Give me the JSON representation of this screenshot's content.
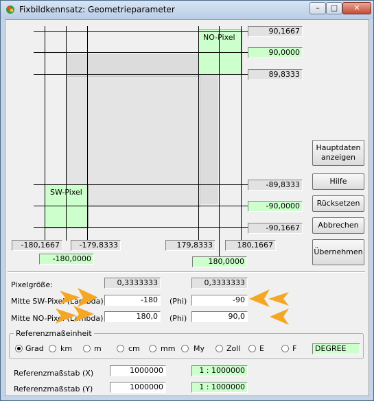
{
  "window": {
    "title": "Fixbildkennsatz: Geometrieparameter",
    "min": "–",
    "max": "□",
    "close": "✕"
  },
  "diagram": {
    "ne_pixel_label": "NO-Pixel",
    "sw_pixel_label": "SW-Pixel",
    "right_values": {
      "v1": "90,1667",
      "v2": "90,0000",
      "v3": "89,8333",
      "v4": "-89,8333",
      "v5": "-90,0000",
      "v6": "-90,1667"
    },
    "bottom_values": {
      "v1": "-180,1667",
      "v2": "-179,8333",
      "v3": "179,8333",
      "v4": "180,1667",
      "v5": "-180,0000",
      "v6": "180,0000"
    }
  },
  "buttons": {
    "hauptdaten": [
      "Hauptdaten",
      "anzeigen"
    ],
    "hilfe": "Hilfe",
    "ruecksetzen": "Rücksetzen",
    "abbrechen": "Abbrechen",
    "uebernehmen": "Übernehmen"
  },
  "params": {
    "pixelgroesse_label": "Pixelgröße:",
    "pixelgroesse_lambda": "0,3333333",
    "pixelgroesse_phi": "0,3333333",
    "sw_label": "Mitte SW-Pixel (Lambda)",
    "sw_lambda": "-180",
    "sw_phi": "-90",
    "no_label": "Mitte NO-Pixel (Lambda)",
    "no_lambda": "180,0",
    "no_phi": "90,0",
    "phi_label": "(Phi)"
  },
  "referenz": {
    "group_title": "Referenzmaßeinheit",
    "options": [
      "Grad",
      "km",
      "m",
      "cm",
      "mm",
      "My",
      "Zoll",
      "E",
      "F"
    ],
    "selected": "Grad",
    "unit_display": "DEGREE"
  },
  "massstab": {
    "x_label": "Referenzmaßstab (X)",
    "x_value": "1000000",
    "x_ratio": "1 : 1000000",
    "y_label": "Referenzmaßstab (Y)",
    "y_value": "1000000",
    "y_ratio": "1 : 1000000"
  },
  "colors": {
    "green_field": "#ccffcc",
    "grey_field": "#e2e2e2",
    "arrow": "#f5a623"
  }
}
